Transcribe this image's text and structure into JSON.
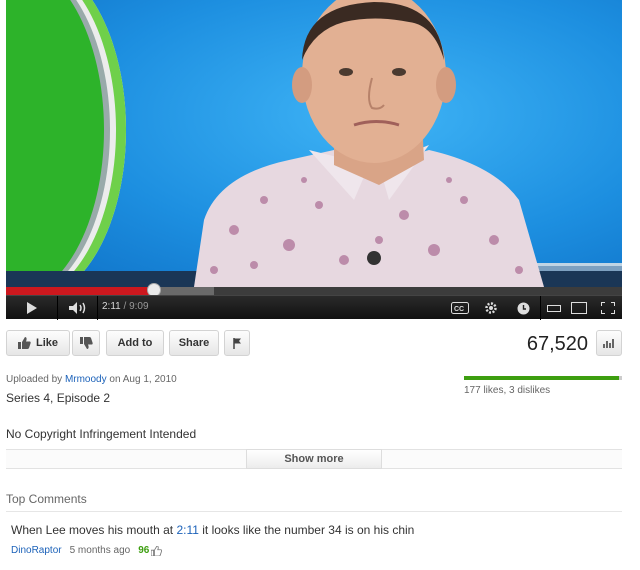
{
  "player": {
    "current_time": "2:11",
    "duration": "9:09",
    "progress_fraction": 0.24
  },
  "actions": {
    "like_label": "Like",
    "add_to_label": "Add to",
    "share_label": "Share"
  },
  "stats": {
    "views": "67,520",
    "likes_dislikes": "177 likes, 3 dislikes",
    "like_ratio": 0.983
  },
  "meta": {
    "uploaded_prefix": "Uploaded by",
    "uploader": "Mrmoody",
    "uploaded_on": "on Aug 1, 2010",
    "subtitle": "Series 4, Episode 2",
    "description": "No Copyright Infringement Intended",
    "show_more": "Show more"
  },
  "comments": {
    "heading": "Top Comments",
    "items": [
      {
        "text_before": "When Lee moves his mouth at",
        "timestamp": "2:11",
        "text_after": "it looks like the number 34 is on his chin",
        "author": "DinoRaptor",
        "age": "5 months ago",
        "score": "96"
      }
    ]
  },
  "colors": {
    "progress_played": "#cc181e",
    "link": "#1c62b9",
    "like_bar": "#3d9e10"
  },
  "icons": [
    "play-icon",
    "volume-icon",
    "cc-icon",
    "gear-icon",
    "clock-icon",
    "small-player-icon",
    "large-player-icon",
    "fullscreen-icon",
    "thumbs-up-icon",
    "thumbs-down-icon",
    "flag-icon",
    "stats-icon"
  ]
}
